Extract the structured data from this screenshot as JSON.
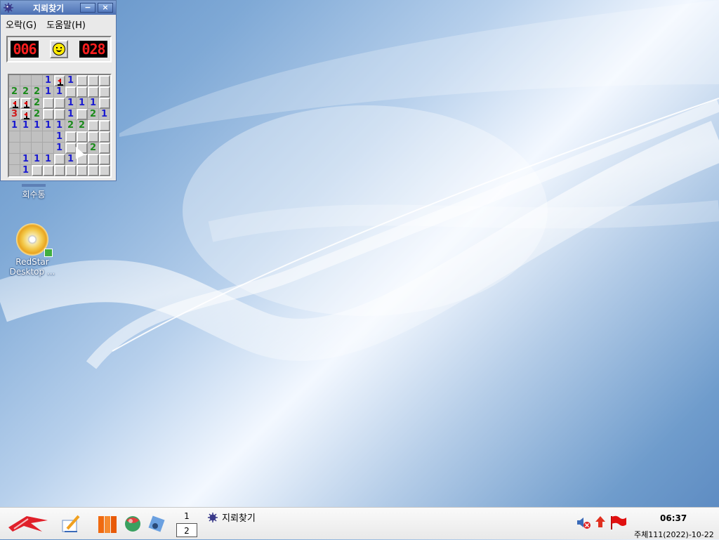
{
  "window": {
    "title": "지뢰찾기",
    "minimize_label": "−",
    "close_label": "×",
    "menu": [
      "오락(G)",
      "도움말(H)"
    ],
    "mine_counter": "006",
    "timer": "028",
    "face": "smiley"
  },
  "board": [
    [
      "o",
      "o",
      "o",
      "1",
      "F",
      "1",
      "h",
      "h",
      "h"
    ],
    [
      "2",
      "2",
      "2",
      "1",
      "1",
      "h",
      "h",
      "h",
      "h"
    ],
    [
      "F",
      "F",
      "2",
      "h",
      "h",
      "1",
      "1",
      "1",
      "h"
    ],
    [
      "3",
      "F",
      "2",
      "h",
      "h",
      "1",
      "h",
      "2",
      "1"
    ],
    [
      "1",
      "1",
      "1",
      "1",
      "1",
      "2",
      "2",
      "h",
      "h"
    ],
    [
      "o",
      "o",
      "o",
      "o",
      "1",
      "h",
      "h",
      "h",
      "h"
    ],
    [
      "o",
      "o",
      "o",
      "o",
      "1",
      "h",
      "h",
      "2",
      "h"
    ],
    [
      "o",
      "1",
      "1",
      "1",
      "h",
      "1",
      "h",
      "h",
      "h"
    ],
    [
      "o",
      "1",
      "h",
      "h",
      "h",
      "h",
      "h",
      "h",
      "h"
    ]
  ],
  "desktop_icons": [
    {
      "label": "회수통",
      "icon": "trash-icon"
    },
    {
      "label": "RedStar Desktop ...",
      "icon": "cd-icon"
    }
  ],
  "taskbar": {
    "pager": [
      "1",
      "2"
    ],
    "active_task": "지뢰찾기",
    "time": "06:37",
    "date": "주체111(2022)-10-22"
  }
}
